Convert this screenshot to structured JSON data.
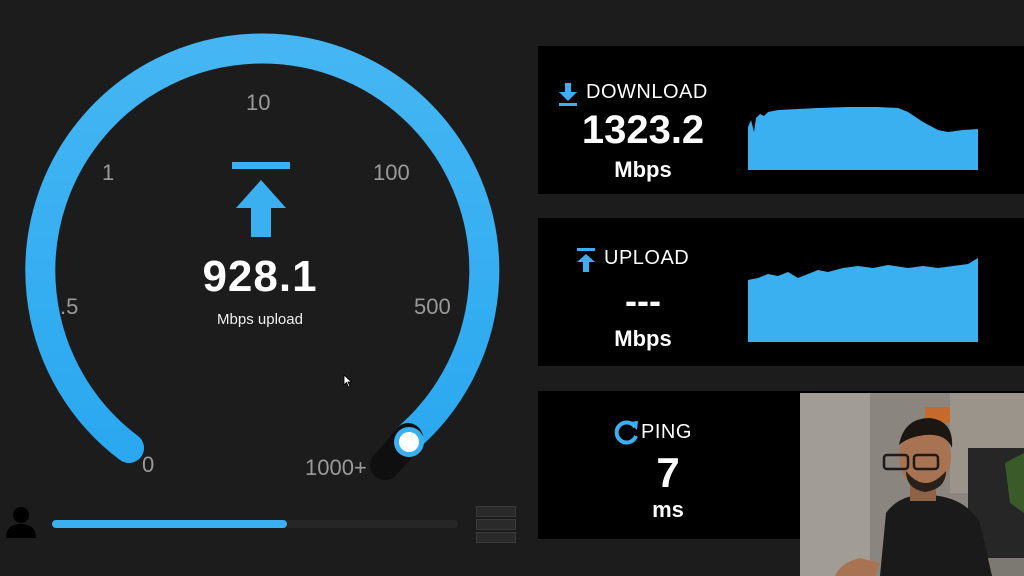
{
  "gauge": {
    "scale_labels": [
      "0",
      ".5",
      "1",
      "10",
      "100",
      "500",
      "1000+"
    ],
    "value": "928.1",
    "unit_label": "Mbps upload",
    "direction_icon": "upload-arrow-icon",
    "accent_color": "#3ab0f0",
    "progress_fraction": 0.58
  },
  "download": {
    "label": "DOWNLOAD",
    "value": "1323.2",
    "unit": "Mbps",
    "icon": "download-arrow-icon"
  },
  "upload": {
    "label": "UPLOAD",
    "value": "---",
    "unit": "Mbps",
    "icon": "upload-arrow-icon"
  },
  "ping": {
    "label": "PING",
    "value": "7",
    "unit": "ms",
    "icon": "refresh-icon"
  },
  "colors": {
    "background": "#1c1c1c",
    "panel": "#000000",
    "accent": "#3ab0f0"
  }
}
